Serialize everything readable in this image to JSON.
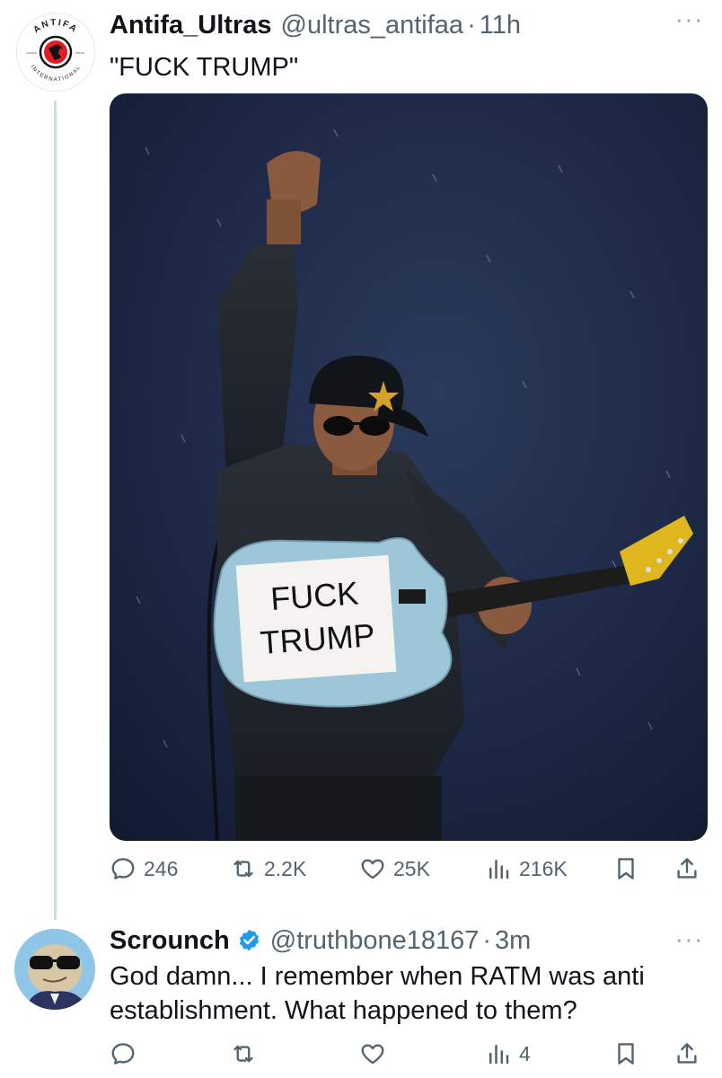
{
  "tweets": [
    {
      "display_name": "Antifa_Ultras",
      "handle": "@ultras_antifaa",
      "time": "11h",
      "text": "\"FUCK TRUMP\"",
      "avatar_icon": "antifa-international-logo",
      "avatar_text": {
        "top": "ANTIFA",
        "bottom": "INTERNATIONAL",
        "left": "ULTRAS",
        "right": "ANTIFA"
      },
      "media_sign_text": "FUCK TRUMP",
      "stats": {
        "replies": "246",
        "reposts": "2.2K",
        "likes": "25K",
        "views": "216K"
      }
    },
    {
      "display_name": "Scrounch",
      "verified": true,
      "handle": "@truthbone18167",
      "time": "3m",
      "text": "God damn... I remember when RATM was anti establishment.  What happened to them?",
      "avatar_icon": "cartoon-sunglasses-avatar",
      "stats": {
        "replies": "",
        "reposts": "",
        "likes": "",
        "views": "4"
      }
    }
  ],
  "separator": "·",
  "more_label": "···",
  "colors": {
    "text": "#0f1419",
    "secondary": "#536471",
    "verified": "#1d9bf0",
    "thread_line": "#cfd9de"
  }
}
